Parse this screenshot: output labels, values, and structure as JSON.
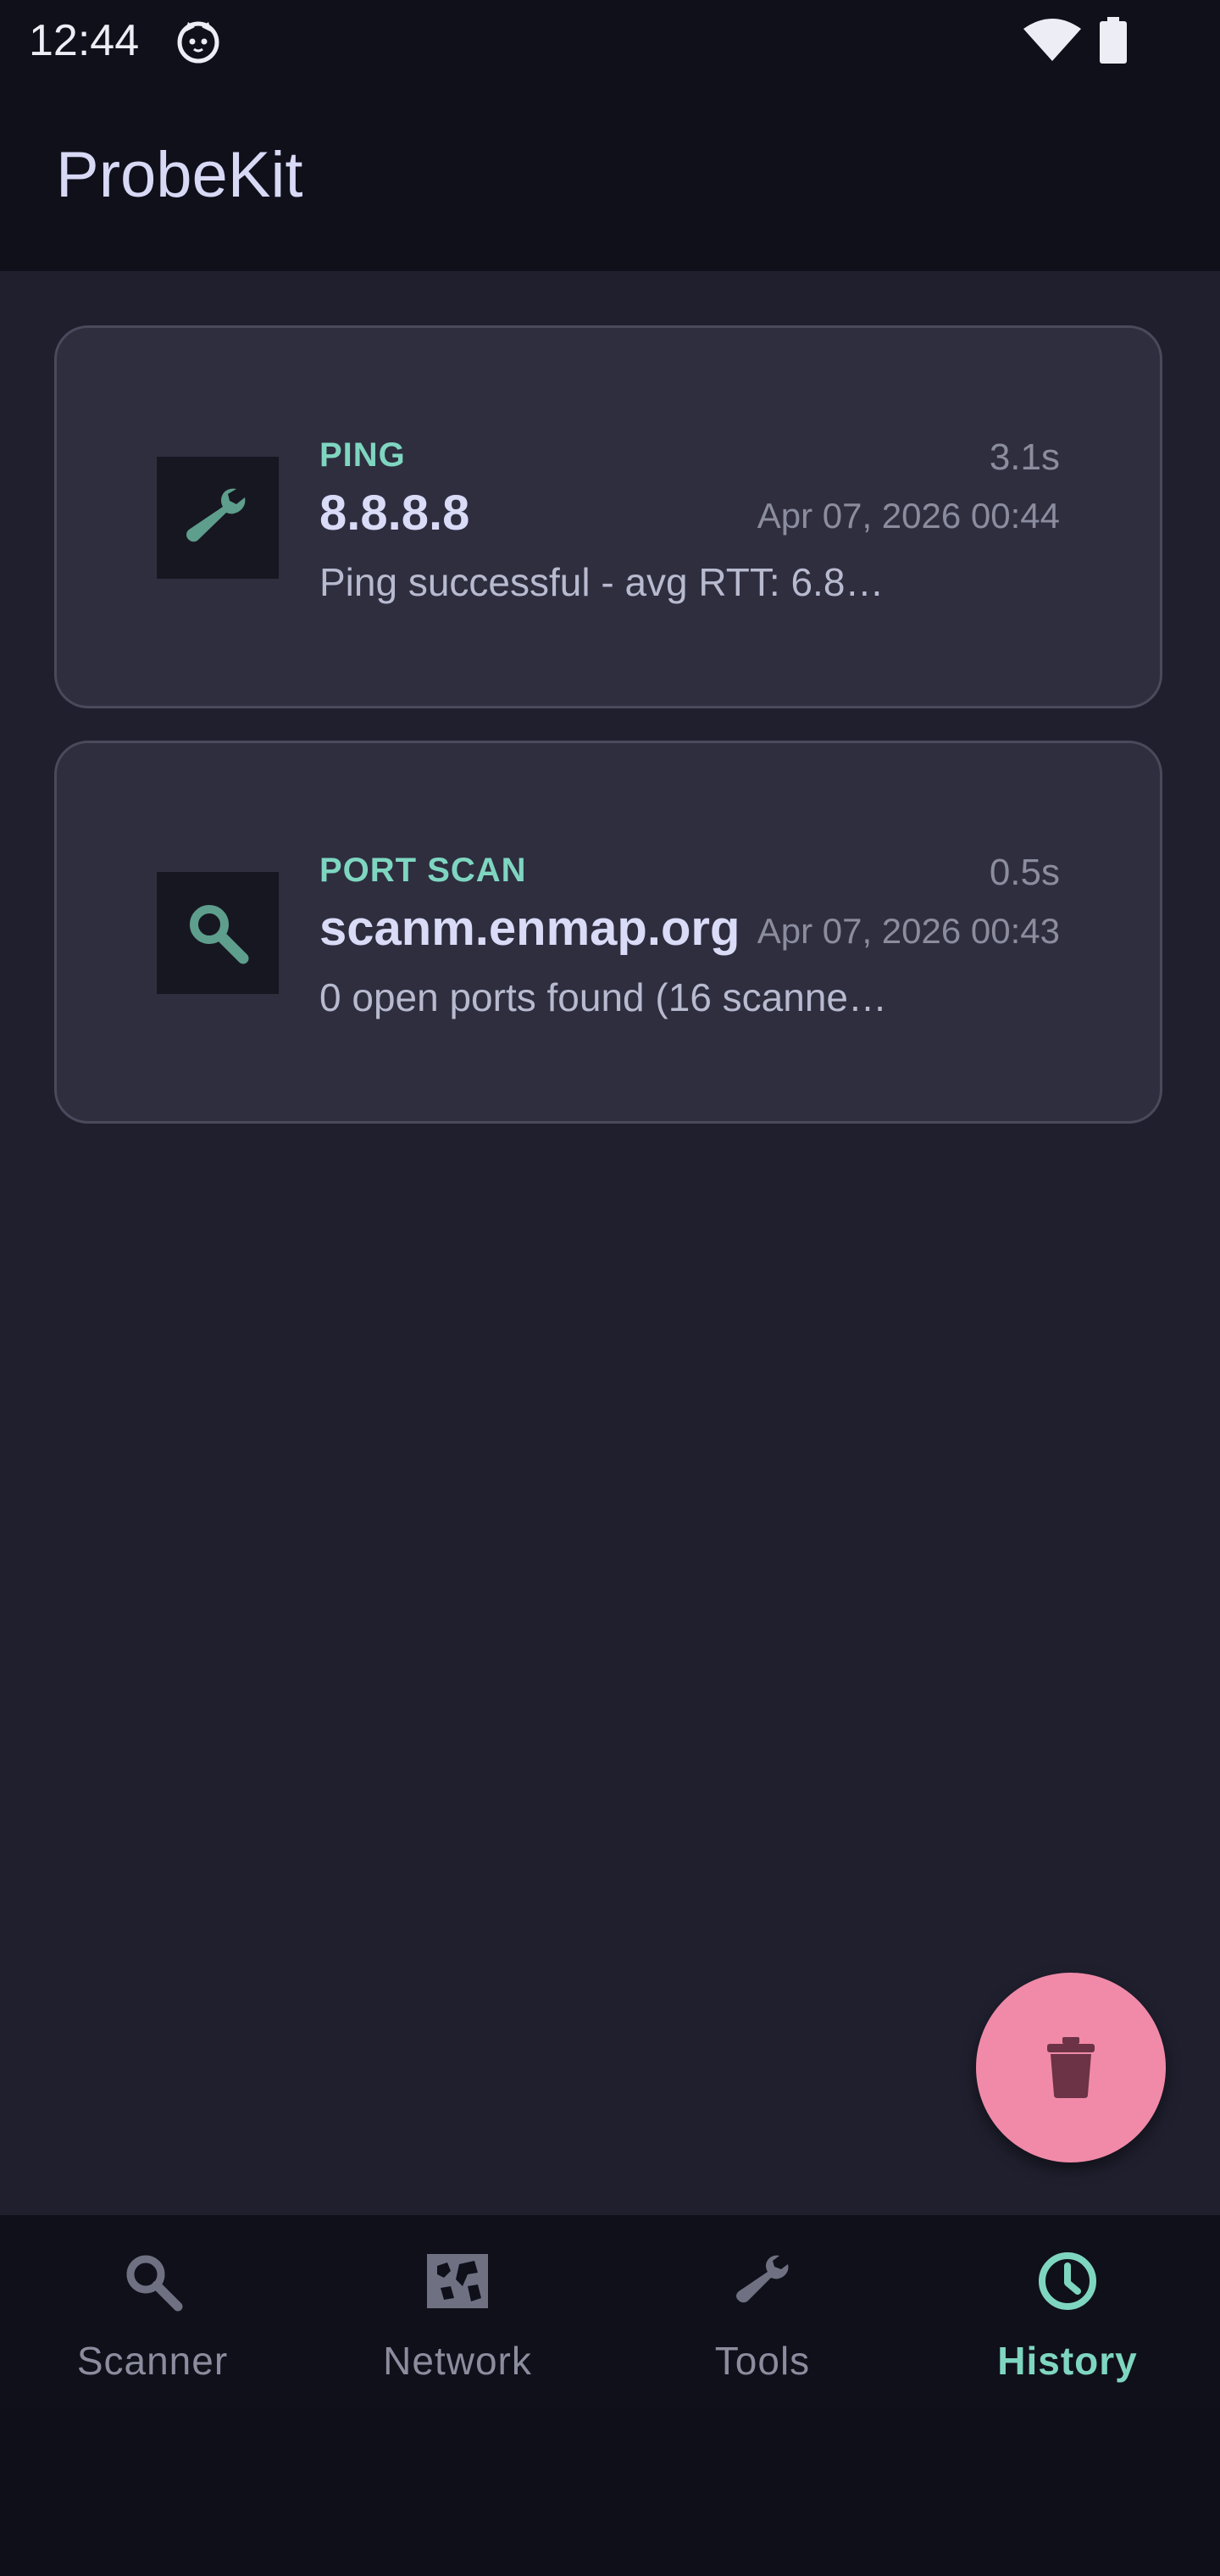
{
  "status_bar": {
    "time": "12:44",
    "icons": [
      "cat-notification-icon",
      "wifi-icon",
      "battery-icon"
    ]
  },
  "app_bar": {
    "title": "ProbeKit"
  },
  "history": [
    {
      "type": "PING",
      "target": "8.8.8.8",
      "summary": "Ping successful - avg RTT: 6.8…",
      "duration": "3.1s",
      "date": "Apr 07, 2026 00:44",
      "icon": "wrench-icon"
    },
    {
      "type": "PORT SCAN",
      "target": "scanm.enmap.org",
      "summary": "0 open ports found (16 scanne…",
      "duration": "0.5s",
      "date": "Apr 07, 2026 00:43",
      "icon": "search-icon"
    }
  ],
  "fab": {
    "icon": "trash-icon"
  },
  "bottom_nav": {
    "items": [
      {
        "label": "Scanner",
        "icon": "search-icon",
        "active": false
      },
      {
        "label": "Network",
        "icon": "map-icon",
        "active": false
      },
      {
        "label": "Tools",
        "icon": "wrench-icon",
        "active": false
      },
      {
        "label": "History",
        "icon": "history-icon",
        "active": true
      }
    ]
  },
  "colors": {
    "accent": "#7fd6c0",
    "fab": "#f08aa8",
    "card_bg": "#2e2e3f",
    "content_bg": "#1f1f2e",
    "bar_bg": "#10101b"
  }
}
